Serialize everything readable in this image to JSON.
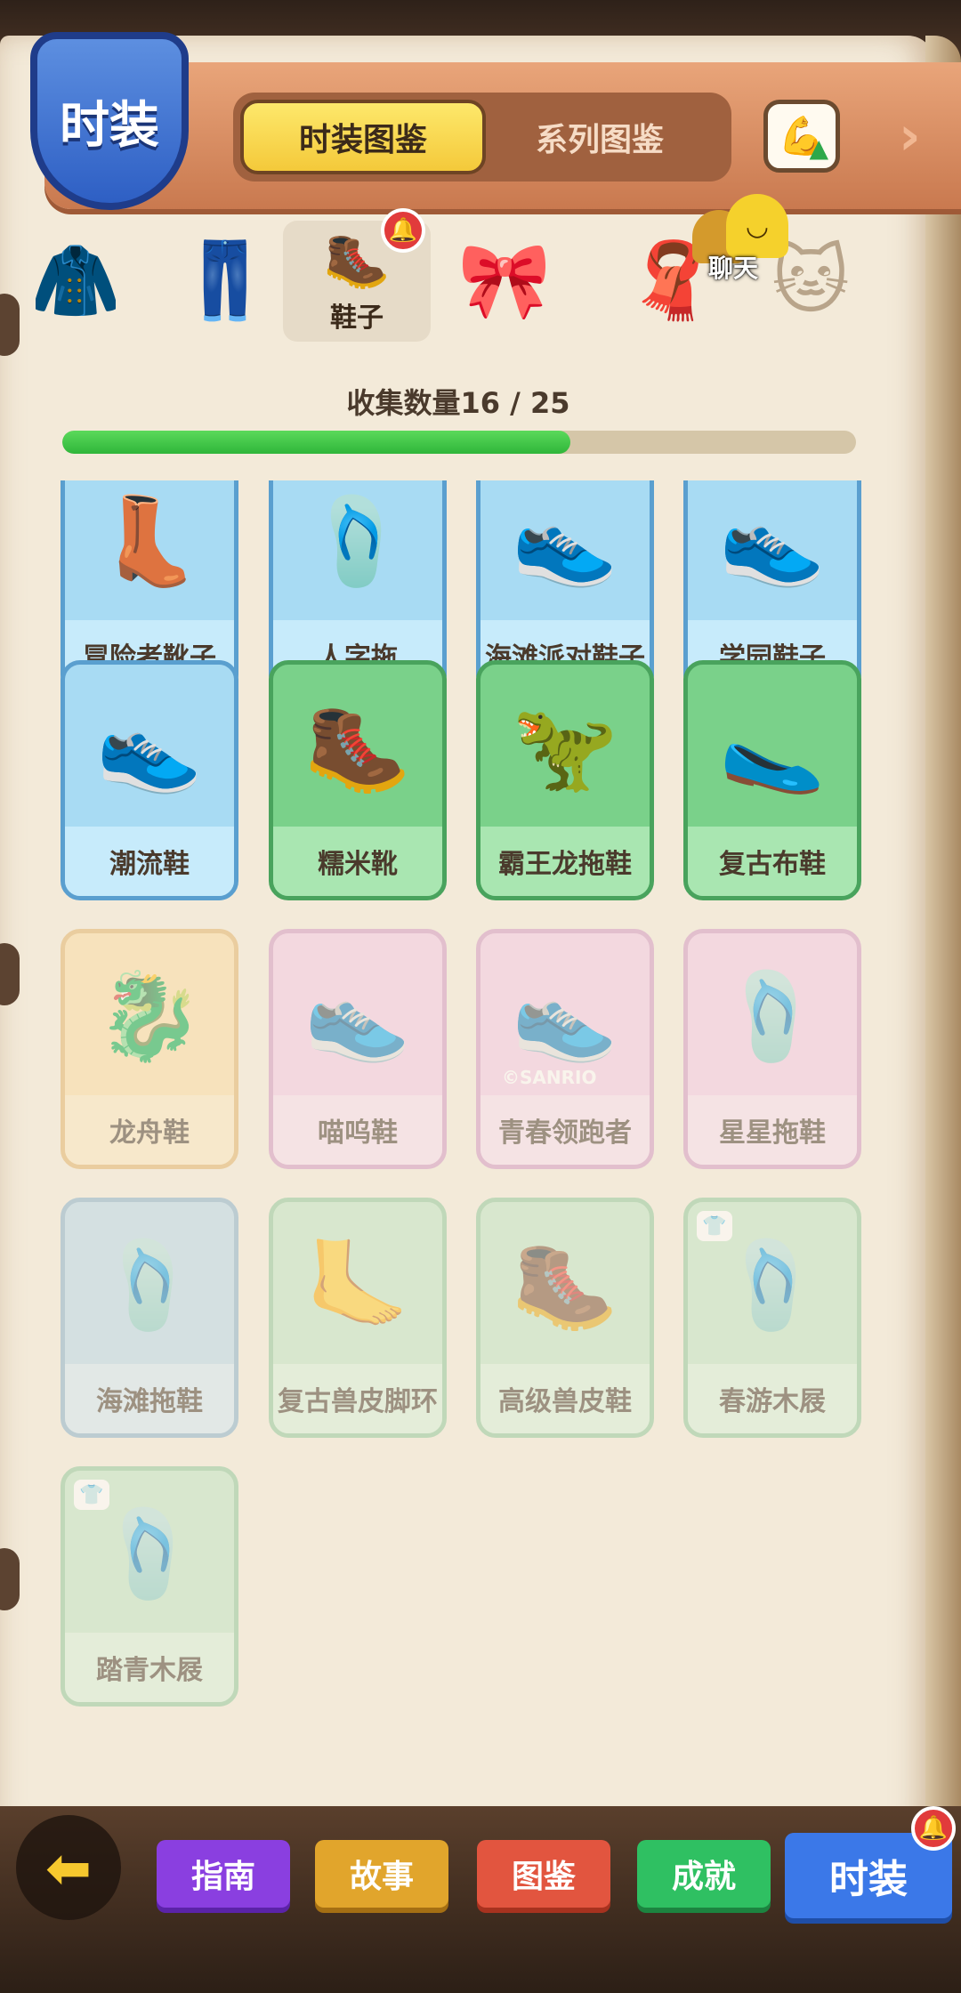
{
  "header": {
    "section_title": "时装",
    "tabs": [
      {
        "label": "时装图鉴",
        "active": true
      },
      {
        "label": "系列图鉴",
        "active": false
      }
    ]
  },
  "categories": {
    "active_label": "鞋子",
    "badge": "🔔",
    "chat_label": "聊天"
  },
  "collection": {
    "label": "收集数量16 / 25",
    "collected": 16,
    "total": 25,
    "progress_color": "#35bb3e"
  },
  "items": [
    {
      "name": "冒险者靴子",
      "style": "blue",
      "icon": "👢"
    },
    {
      "name": "人字拖",
      "style": "blue",
      "icon": "🩴"
    },
    {
      "name": "海滩派对鞋子",
      "style": "blue",
      "icon": "👟"
    },
    {
      "name": "学园鞋子",
      "style": "blue",
      "icon": "👟"
    },
    {
      "name": "潮流鞋",
      "style": "blue",
      "icon": "👟"
    },
    {
      "name": "糯米靴",
      "style": "green",
      "icon": "🥾"
    },
    {
      "name": "霸王龙拖鞋",
      "style": "green",
      "icon": "🦖"
    },
    {
      "name": "复古布鞋",
      "style": "green",
      "icon": "🥿"
    },
    {
      "name": "龙舟鞋",
      "style": "yellow",
      "icon": "🐉"
    },
    {
      "name": "喵呜鞋",
      "style": "pink",
      "icon": "👟"
    },
    {
      "name": "青春领跑者",
      "style": "pink",
      "icon": "👟",
      "note": "©SANRIO"
    },
    {
      "name": "星星拖鞋",
      "style": "pink",
      "icon": "🩴"
    },
    {
      "name": "海滩拖鞋",
      "style": "paleblue",
      "icon": "🩴"
    },
    {
      "name": "复古兽皮脚环",
      "style": "palegreen",
      "icon": "🦶"
    },
    {
      "name": "高级兽皮鞋",
      "style": "palegreen",
      "icon": "🥾"
    },
    {
      "name": "春游木屐",
      "style": "palegreen",
      "icon": "🩴",
      "tag": "👕"
    },
    {
      "name": "踏青木屐",
      "style": "palegreen",
      "icon": "🩴",
      "tag": "👕"
    }
  ],
  "bottom_nav": [
    {
      "label": "指南",
      "color": "#8a3fe0"
    },
    {
      "label": "故事",
      "color": "#e1a52c"
    },
    {
      "label": "图鉴",
      "color": "#e2553f"
    },
    {
      "label": "成就",
      "color": "#2fc062"
    },
    {
      "label": "时装",
      "color": "#3b78e8",
      "active": true
    }
  ],
  "icons": {
    "back": "arrow-left-icon",
    "upgrade": "flex-arm-icon",
    "next": "chevron-right-icon"
  }
}
